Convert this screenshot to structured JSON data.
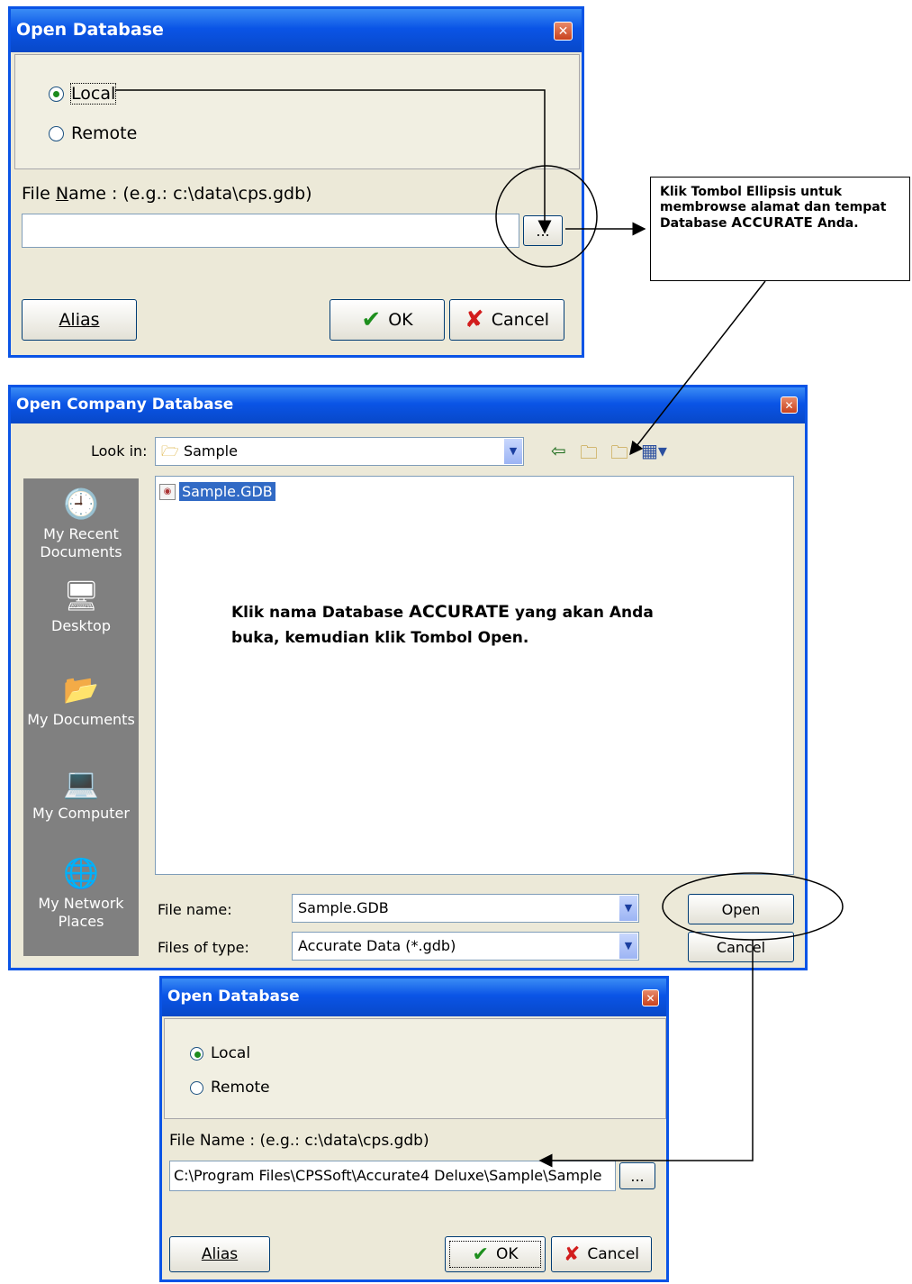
{
  "dialog1": {
    "title": "Open Database",
    "close": "✕",
    "radio_local": "Local",
    "radio_remote": "Remote",
    "filename_label_pre": "File ",
    "filename_label_ul": "N",
    "filename_label_post": "ame :  (e.g.: c:\\data\\cps.gdb)",
    "filename_value": "",
    "ellipsis": "...",
    "alias": "Alias",
    "ok": "OK",
    "cancel": "Cancel"
  },
  "callout_text": {
    "pre": "Klik Tombol Ellipsis untuk membrowse alamat dan tempat Database ",
    "brand": "ACCURATE",
    "post": " Anda."
  },
  "dialog2": {
    "title": "Open Company Database",
    "close": "✕",
    "lookin_label": "Look in:",
    "lookin_value": "Sample",
    "places": [
      {
        "label": "My Recent Documents",
        "icon": "recent-documents-icon",
        "glyph": "🕘"
      },
      {
        "label": "Desktop",
        "icon": "desktop-icon",
        "glyph": "🖥"
      },
      {
        "label": "My Documents",
        "icon": "my-documents-icon",
        "glyph": "📂"
      },
      {
        "label": "My Computer",
        "icon": "my-computer-icon",
        "glyph": "💻"
      },
      {
        "label": "My Network Places",
        "icon": "network-places-icon",
        "glyph": "🌐"
      }
    ],
    "files": [
      "Sample.GDB"
    ],
    "annotation_pre": "Klik nama Database ",
    "annotation_brand": "ACCURATE",
    "annotation_post": " yang akan Anda buka, kemudian klik Tombol Open.",
    "filename_label": "File name:",
    "filename_value": "Sample.GDB",
    "filetype_label": "Files of type:",
    "filetype_value": "Accurate Data (*.gdb)",
    "open": "Open",
    "cancel": "Cancel"
  },
  "dialog3": {
    "title": "Open Database",
    "close": "✕",
    "radio_local": "Local",
    "radio_remote": "Remote",
    "filename_label": "File Name :  (e.g.: c:\\data\\cps.gdb)",
    "filename_value": "C:\\Program Files\\CPSSoft\\Accurate4 Deluxe\\Sample\\Sample",
    "ellipsis": "...",
    "alias": "Alias",
    "ok": "OK",
    "cancel": "Cancel"
  },
  "colors": {
    "title_blue": "#0a54e6",
    "dialog_bg": "#ece9d8",
    "selection": "#316ac5"
  }
}
